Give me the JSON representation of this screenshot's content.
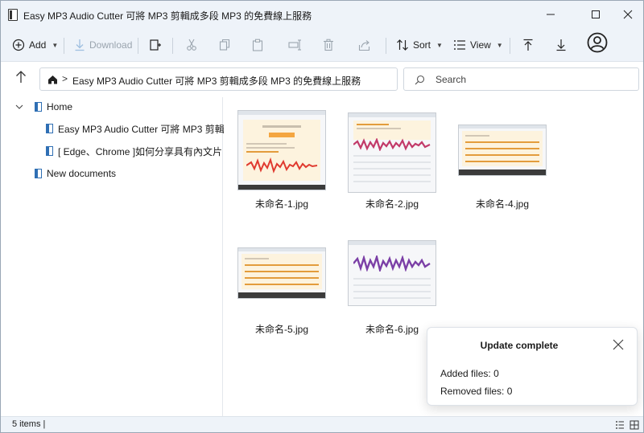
{
  "window": {
    "title": "Easy MP3 Audio Cutter 可將 MP3 剪輯成多段 MP3 的免費線上服務",
    "minimize_glyph": "—",
    "maximize_glyph": "☐",
    "close_glyph": "✕"
  },
  "toolbar": {
    "add_label": "Add",
    "download_label": "Download",
    "sort_label": "Sort",
    "view_label": "View"
  },
  "address": {
    "path_label": "Easy MP3 Audio Cutter 可將 MP3 剪輯成多段 MP3 的免費線上服務",
    "search_placeholder": "Search"
  },
  "nav": {
    "items": [
      {
        "label": "Home"
      },
      {
        "label": "Easy MP3 Audio Cutter 可將 MP3 剪輯"
      },
      {
        "label": "[ Edge、Chrome ]如何分享具有內文片"
      },
      {
        "label": "New documents"
      }
    ]
  },
  "files": [
    {
      "name": "未命名-1.jpg"
    },
    {
      "name": "未命名-2.jpg"
    },
    {
      "name": "未命名-4.jpg"
    },
    {
      "name": "未命名-5.jpg"
    },
    {
      "name": "未命名-6.jpg"
    }
  ],
  "popup": {
    "title": "Update complete",
    "added_label": "Added files:",
    "added_value": "0",
    "removed_label": "Removed files:",
    "removed_value": "0"
  },
  "status": {
    "items_text": "5 items |"
  },
  "colors": {
    "accent": "#2f6fb4",
    "chrome_bg": "#eef3f9",
    "waveform_red": "#e03a2f",
    "waveform_purple": "#7b3fa6",
    "highlight_orange": "#f4a641"
  }
}
